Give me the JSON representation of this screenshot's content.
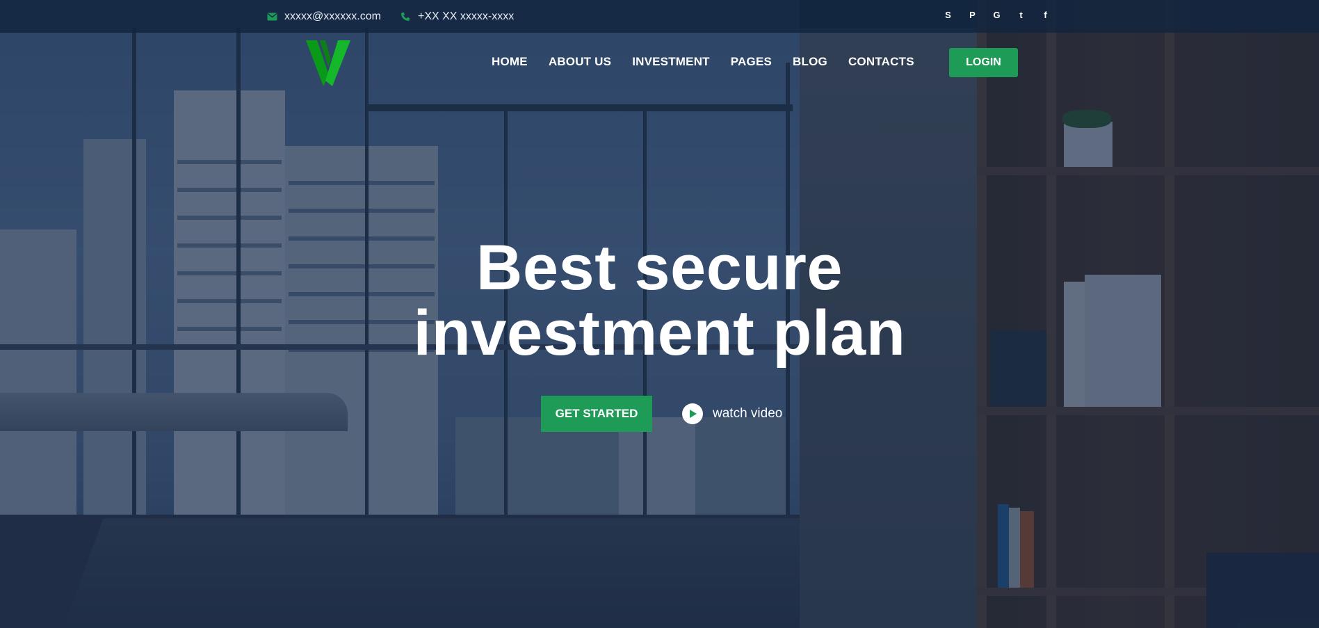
{
  "topbar": {
    "email": "xxxxx@xxxxxx.com",
    "phone": "+XX XX xxxxx-xxxx",
    "social": [
      "skype-icon",
      "pinterest-icon",
      "google-icon",
      "twitter-icon",
      "facebook-icon"
    ],
    "social_glyphs": [
      "S",
      "P",
      "G",
      "t",
      "f"
    ]
  },
  "nav": {
    "items": [
      "HOME",
      "ABOUT US",
      "INVESTMENT",
      "PAGES",
      "BLOG",
      "CONTACTS"
    ],
    "login_label": "LOGIN"
  },
  "hero": {
    "title_line1": "Best secure",
    "title_line2": "investment plan",
    "cta_label": "GET STARTED",
    "video_label": "watch video"
  },
  "colors": {
    "accent": "#1e9b57",
    "logo_green": "#0a9a1a",
    "overlay": "#0e2240"
  }
}
